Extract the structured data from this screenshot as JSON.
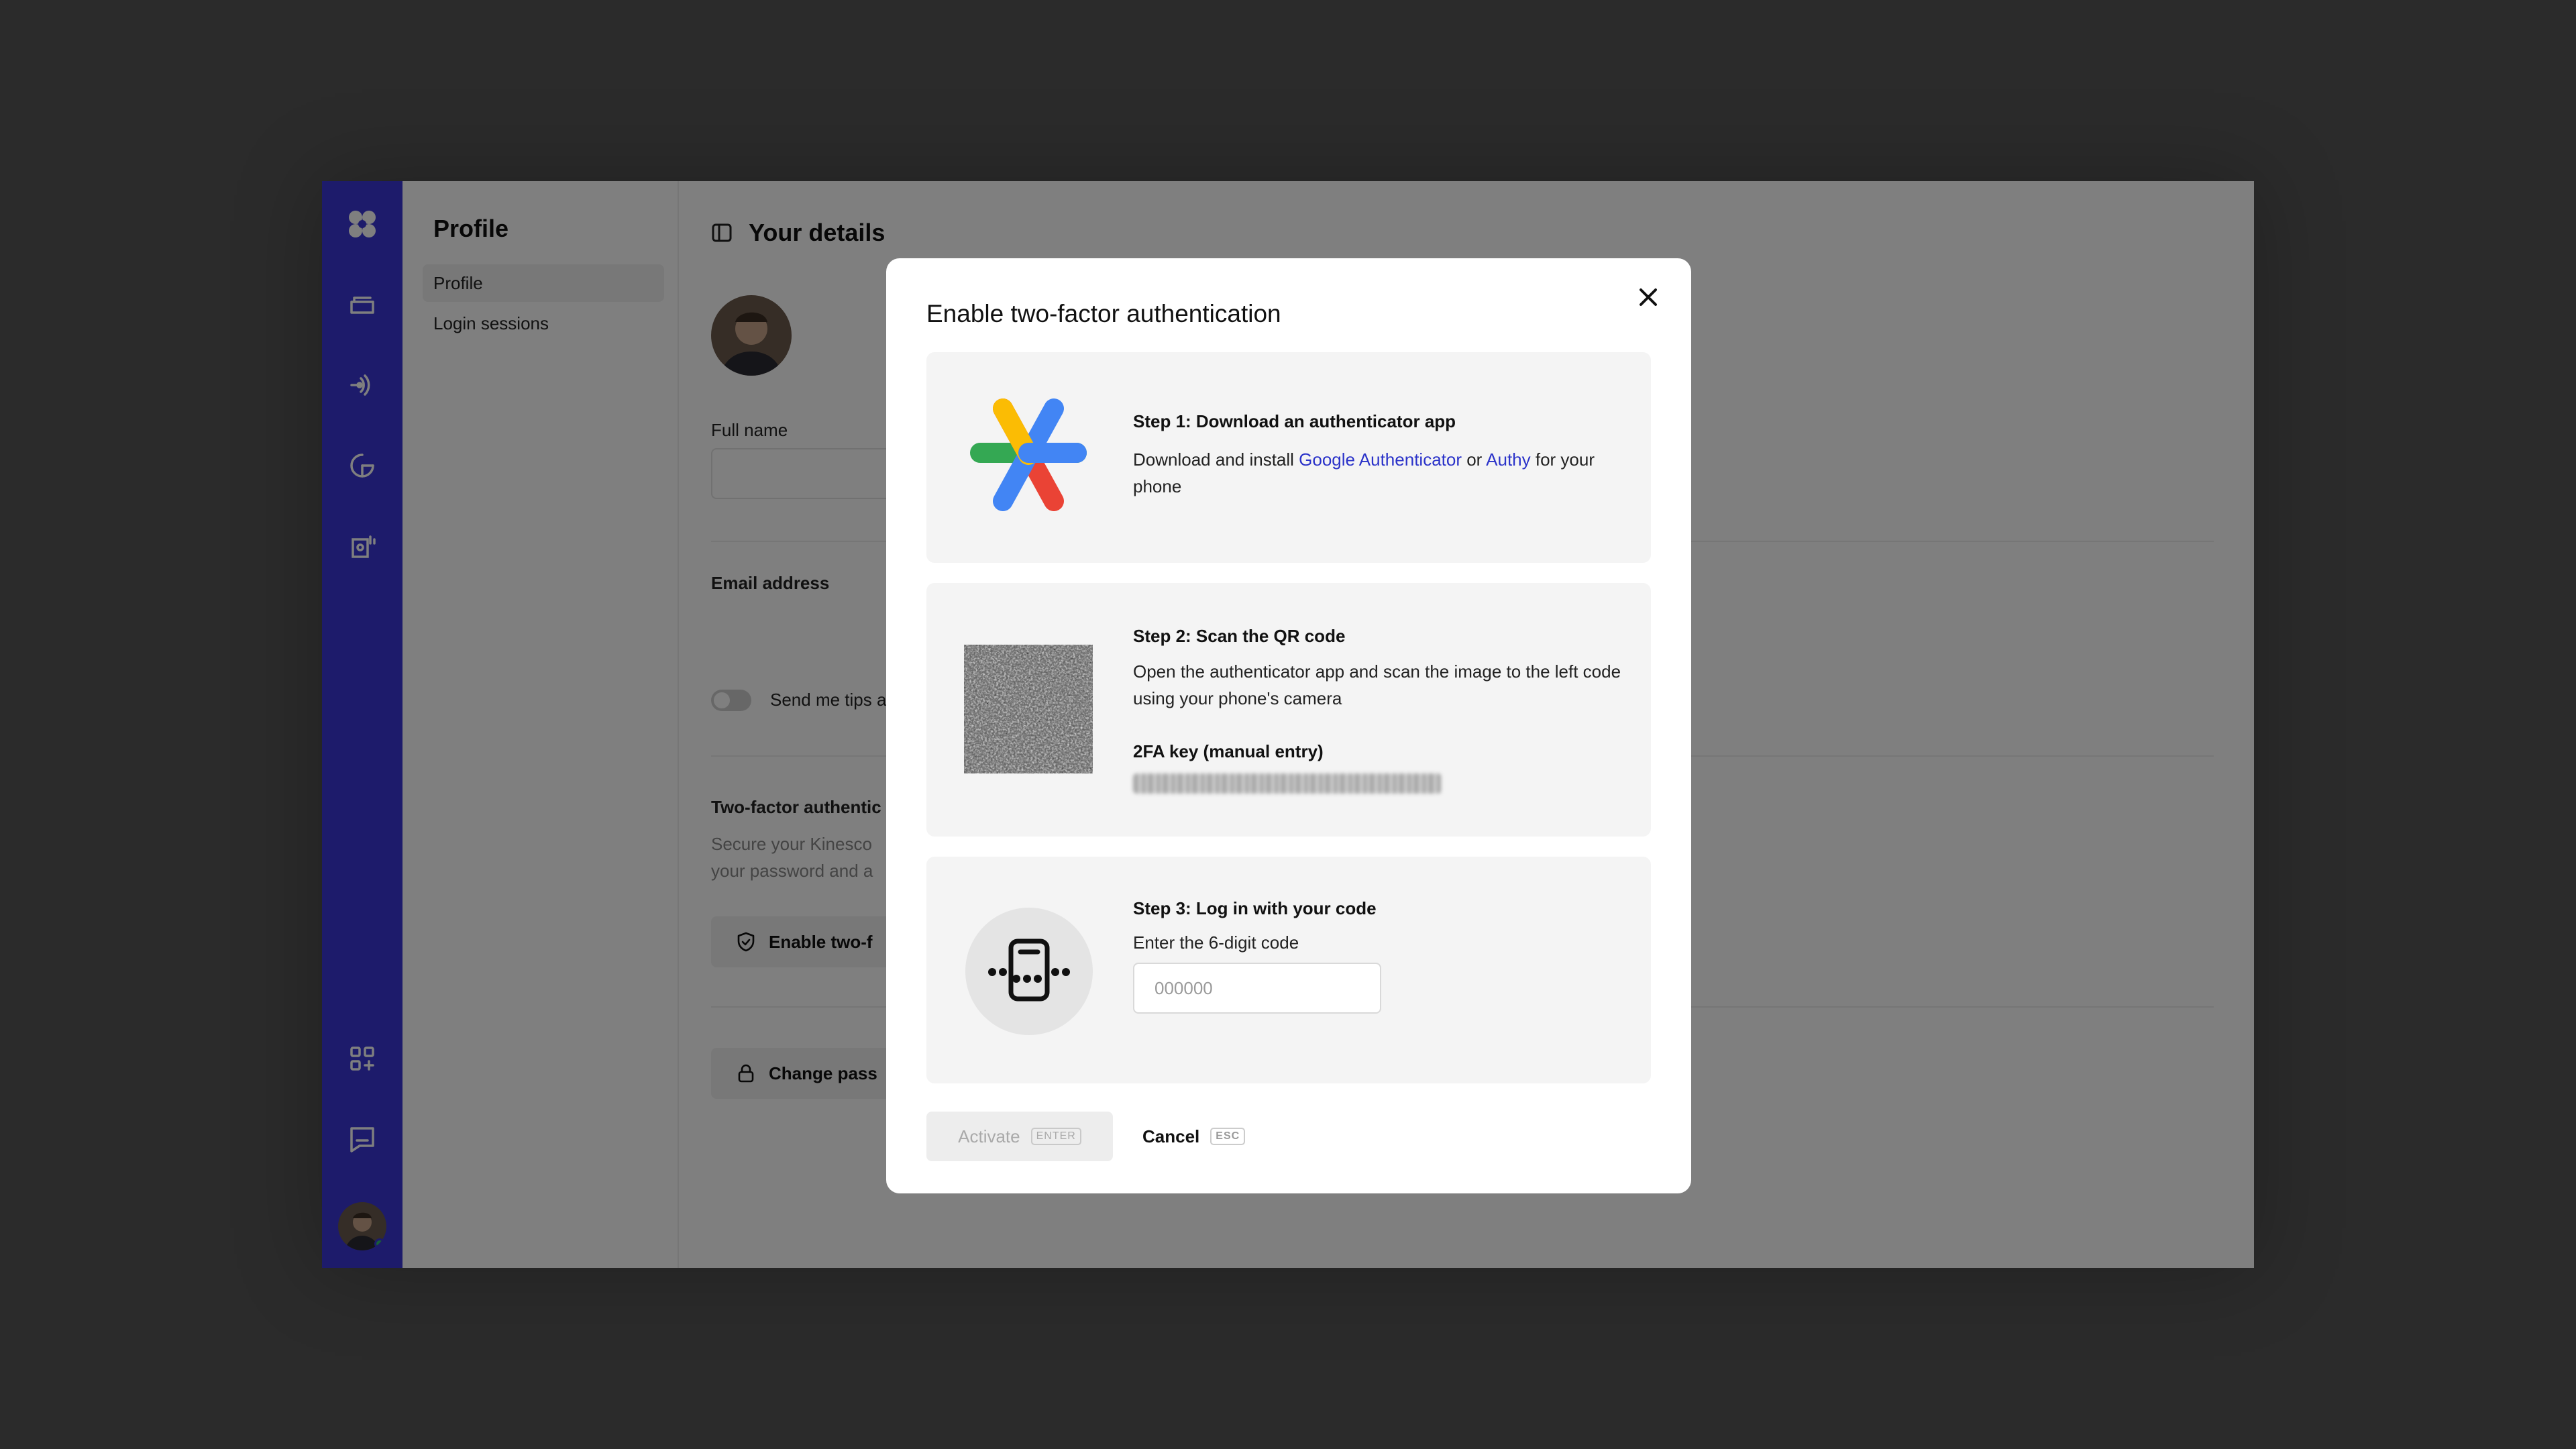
{
  "app": {
    "subnav": {
      "title": "Profile",
      "items": [
        {
          "label": "Profile",
          "active": true
        },
        {
          "label": "Login sessions",
          "active": false
        }
      ]
    },
    "main": {
      "title": "Your details",
      "full_name_label": "Full name",
      "email_label": "Email address",
      "tips_toggle_label": "Send me tips a",
      "twofa_heading": "Two-factor authentic",
      "twofa_desc_line1": "Secure your Kinesco",
      "twofa_desc_line2": "your password and a",
      "enable_button": "Enable two-f",
      "change_password_button": "Change pass"
    }
  },
  "modal": {
    "title": "Enable two-factor authentication",
    "close_icon": "close-icon",
    "steps": [
      {
        "title": "Step 1: Download an authenticator app",
        "desc_prefix": "Download and install ",
        "link1": "Google Authenticator",
        "desc_mid": " or ",
        "link2": "Authy",
        "desc_suffix": " for your phone",
        "icon": "authenticator-logo-icon"
      },
      {
        "title": "Step 2: Scan the QR code",
        "desc": "Open the authenticator app and scan the image to the left code using your phone's camera",
        "key_label": "2FA key (manual entry)",
        "icon": "qr-code"
      },
      {
        "title": "Step 3: Log in with your code",
        "desc": "Enter the 6-digit code",
        "placeholder": "000000",
        "icon": "code-entry-icon"
      }
    ],
    "actions": {
      "activate_label": "Activate",
      "activate_kbd": "ENTER",
      "cancel_label": "Cancel",
      "cancel_kbd": "ESC"
    }
  },
  "colors": {
    "rail": "#3b36d6",
    "link": "#2b33c9",
    "overlay": "rgba(0,0,0,0.5)"
  }
}
